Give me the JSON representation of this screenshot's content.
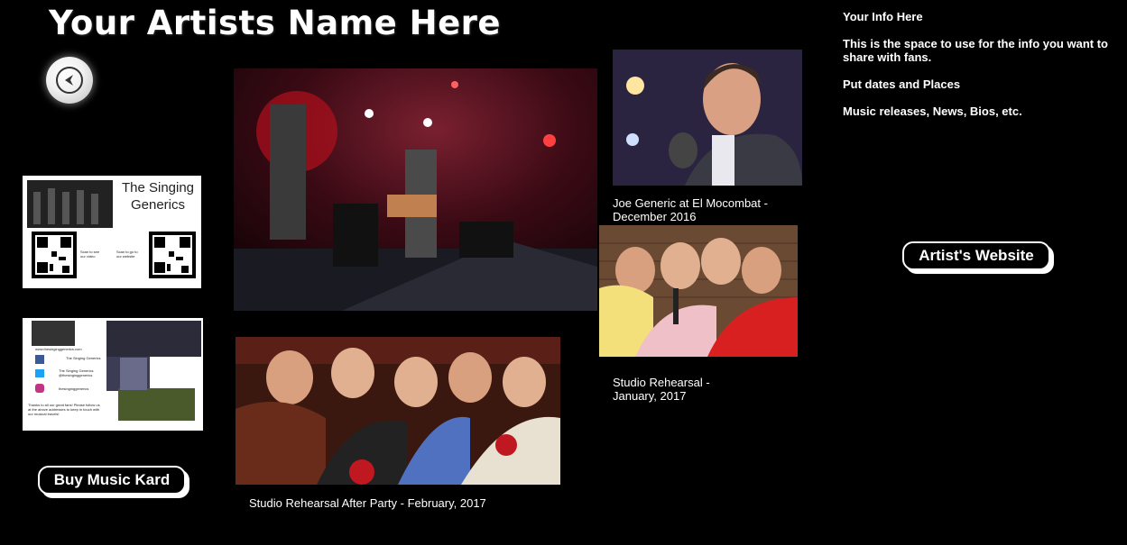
{
  "header": {
    "title": "Your Artists Name Here"
  },
  "nav": {
    "back_icon": "back-arrow-icon"
  },
  "cards": {
    "card1_title": "The Singing Generics",
    "card1_qr1_label": "Scan to see our video",
    "card1_qr2_label": "Scan to go to our website",
    "card2_site": "www.thesinginggenerics.com",
    "card2_fb": "The Singing Generics",
    "card2_tw": "The Singing Generics @thesinginggenerics",
    "card2_ig": "thesinginggenerics",
    "card2_thanks": "Thanks to all our great fans! Please follow us at the above addresses to keep in touch with our musical travels!"
  },
  "buttons": {
    "buy": "Buy Music Kard",
    "website": "Artist's Website"
  },
  "captions": {
    "concert": "",
    "joe": "Joe Generic at El Mocombat - December 2016",
    "studio": "Studio Rehearsal - January, 2017",
    "party": "Studio Rehearsal After Party - February, 2017"
  },
  "info": {
    "heading": "Your Info Here",
    "line1": "This is the space to use for the info you want to share with fans.",
    "line2": "Put dates and Places",
    "line3": "Music releases, News, Bios, etc."
  },
  "colors": {
    "background": "#000000",
    "text": "#ffffff"
  }
}
